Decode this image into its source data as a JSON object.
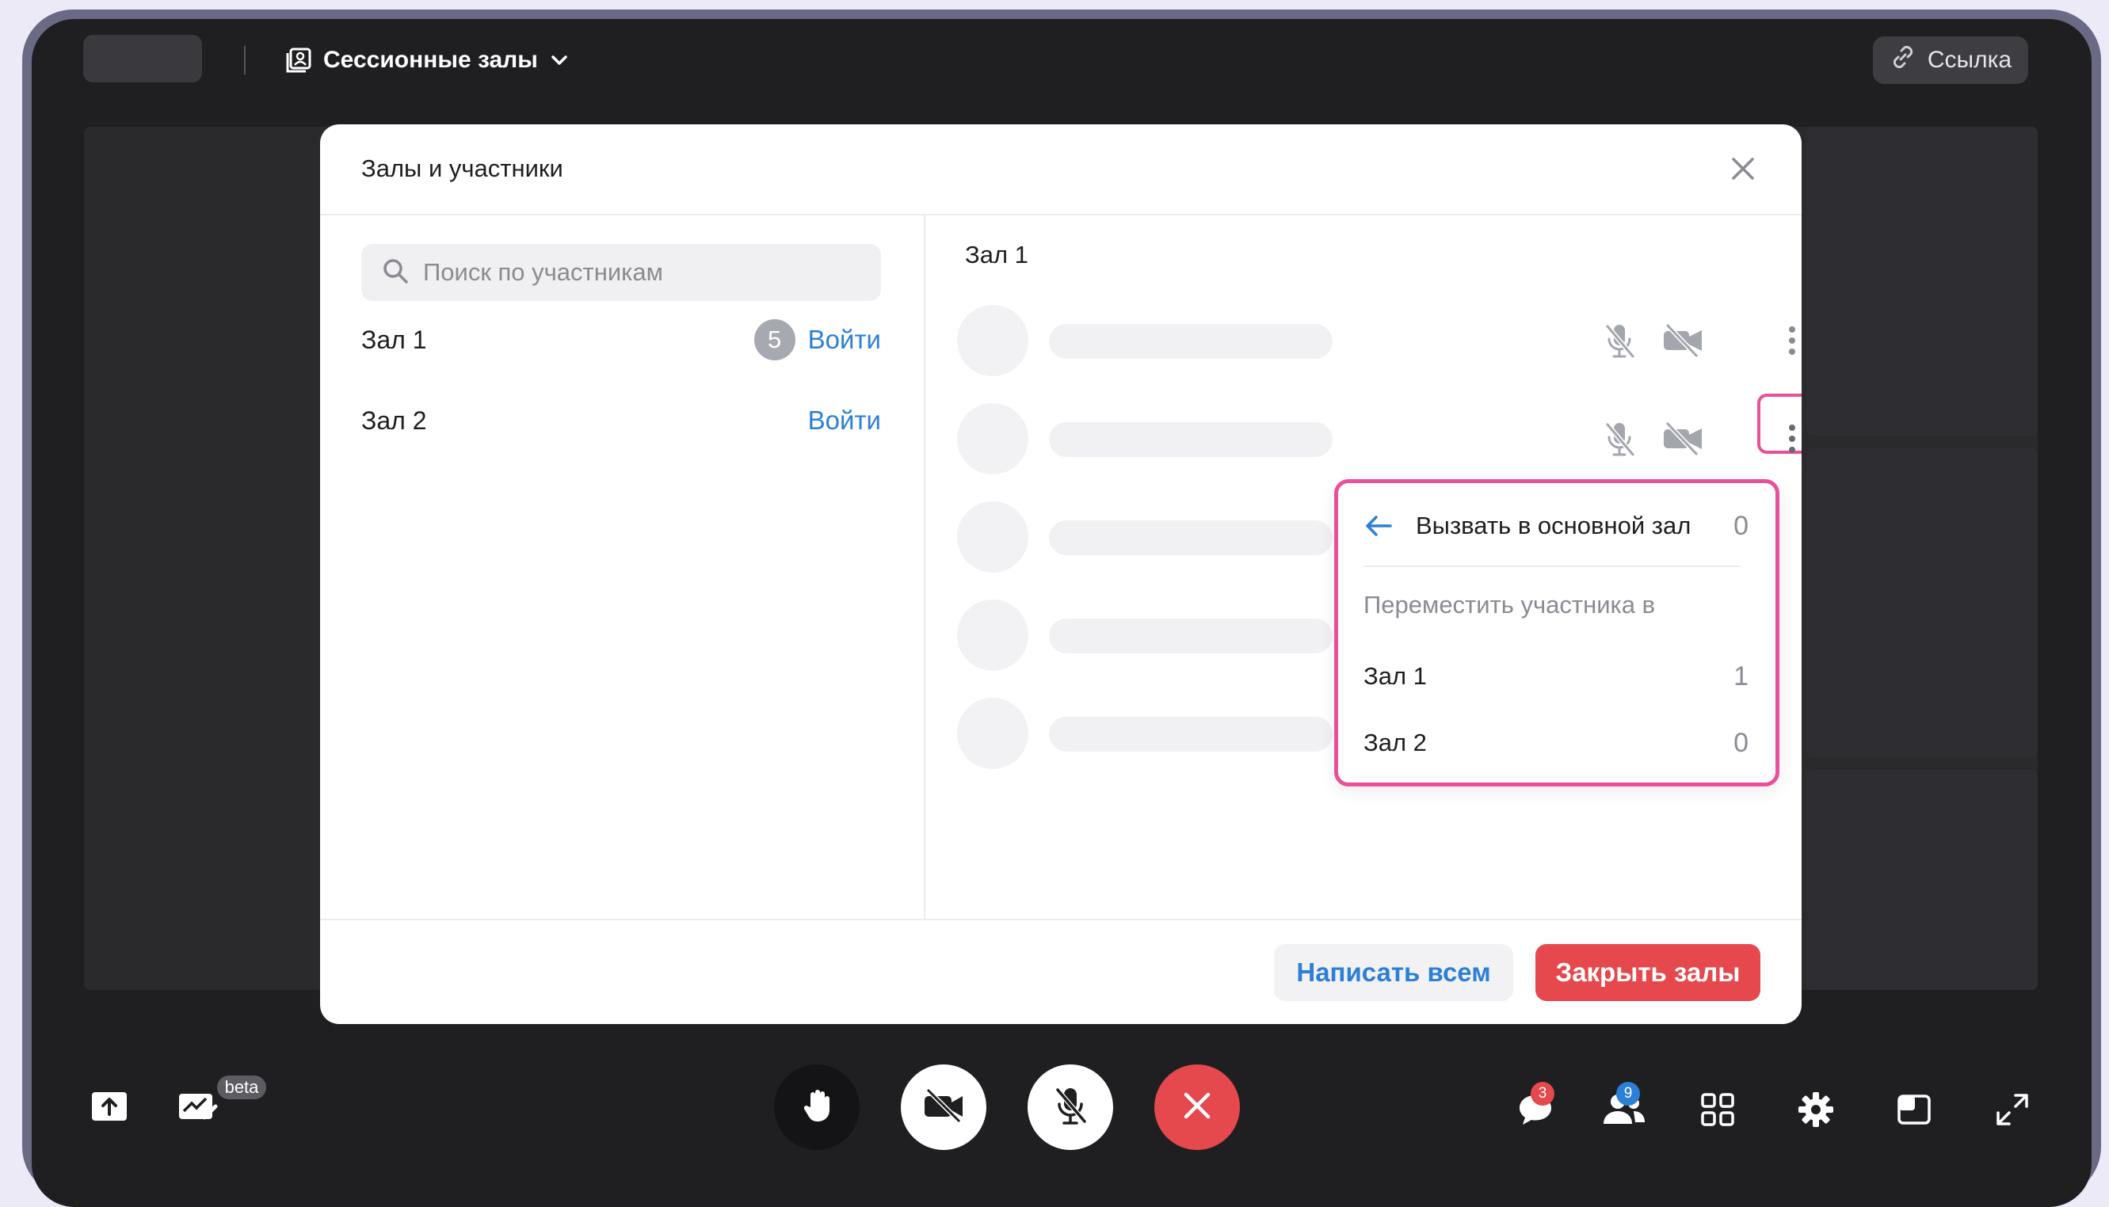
{
  "header": {
    "topic_title": "Сессионные залы",
    "link_button": "Ссылка"
  },
  "modal": {
    "title": "Залы и участники",
    "search_placeholder": "Поиск по участникам",
    "rooms": [
      {
        "name": "Зал 1",
        "count": "5",
        "action": "Войти"
      },
      {
        "name": "Зал 2",
        "count": "",
        "action": "Войти"
      }
    ],
    "current_room": "Зал 1",
    "participant_menu": {
      "back_label": "Вызвать в основной зал",
      "back_count": "0",
      "section_title": "Переместить участника в",
      "targets": [
        {
          "name": "Зал 1",
          "count": "1"
        },
        {
          "name": "Зал 2",
          "count": "0"
        }
      ]
    },
    "footer": {
      "message_all": "Написать всем",
      "close_rooms": "Закрыть залы"
    }
  },
  "toolbar": {
    "beta_label": "beta",
    "chat_badge": "3",
    "participants_badge": "9"
  },
  "colors": {
    "accent": "#2c7fd6",
    "danger": "#e5484d",
    "highlight": "#e9509a",
    "background": "#1f1f22"
  },
  "icons": {
    "topic": "rooms-icon",
    "dropdown": "chevron-down-icon",
    "link": "link-icon",
    "close": "close-icon",
    "search": "search-icon",
    "mic_off": "mic-off-icon",
    "cam_off": "camera-off-icon",
    "more": "more-vertical-icon",
    "back": "arrow-left-icon"
  }
}
